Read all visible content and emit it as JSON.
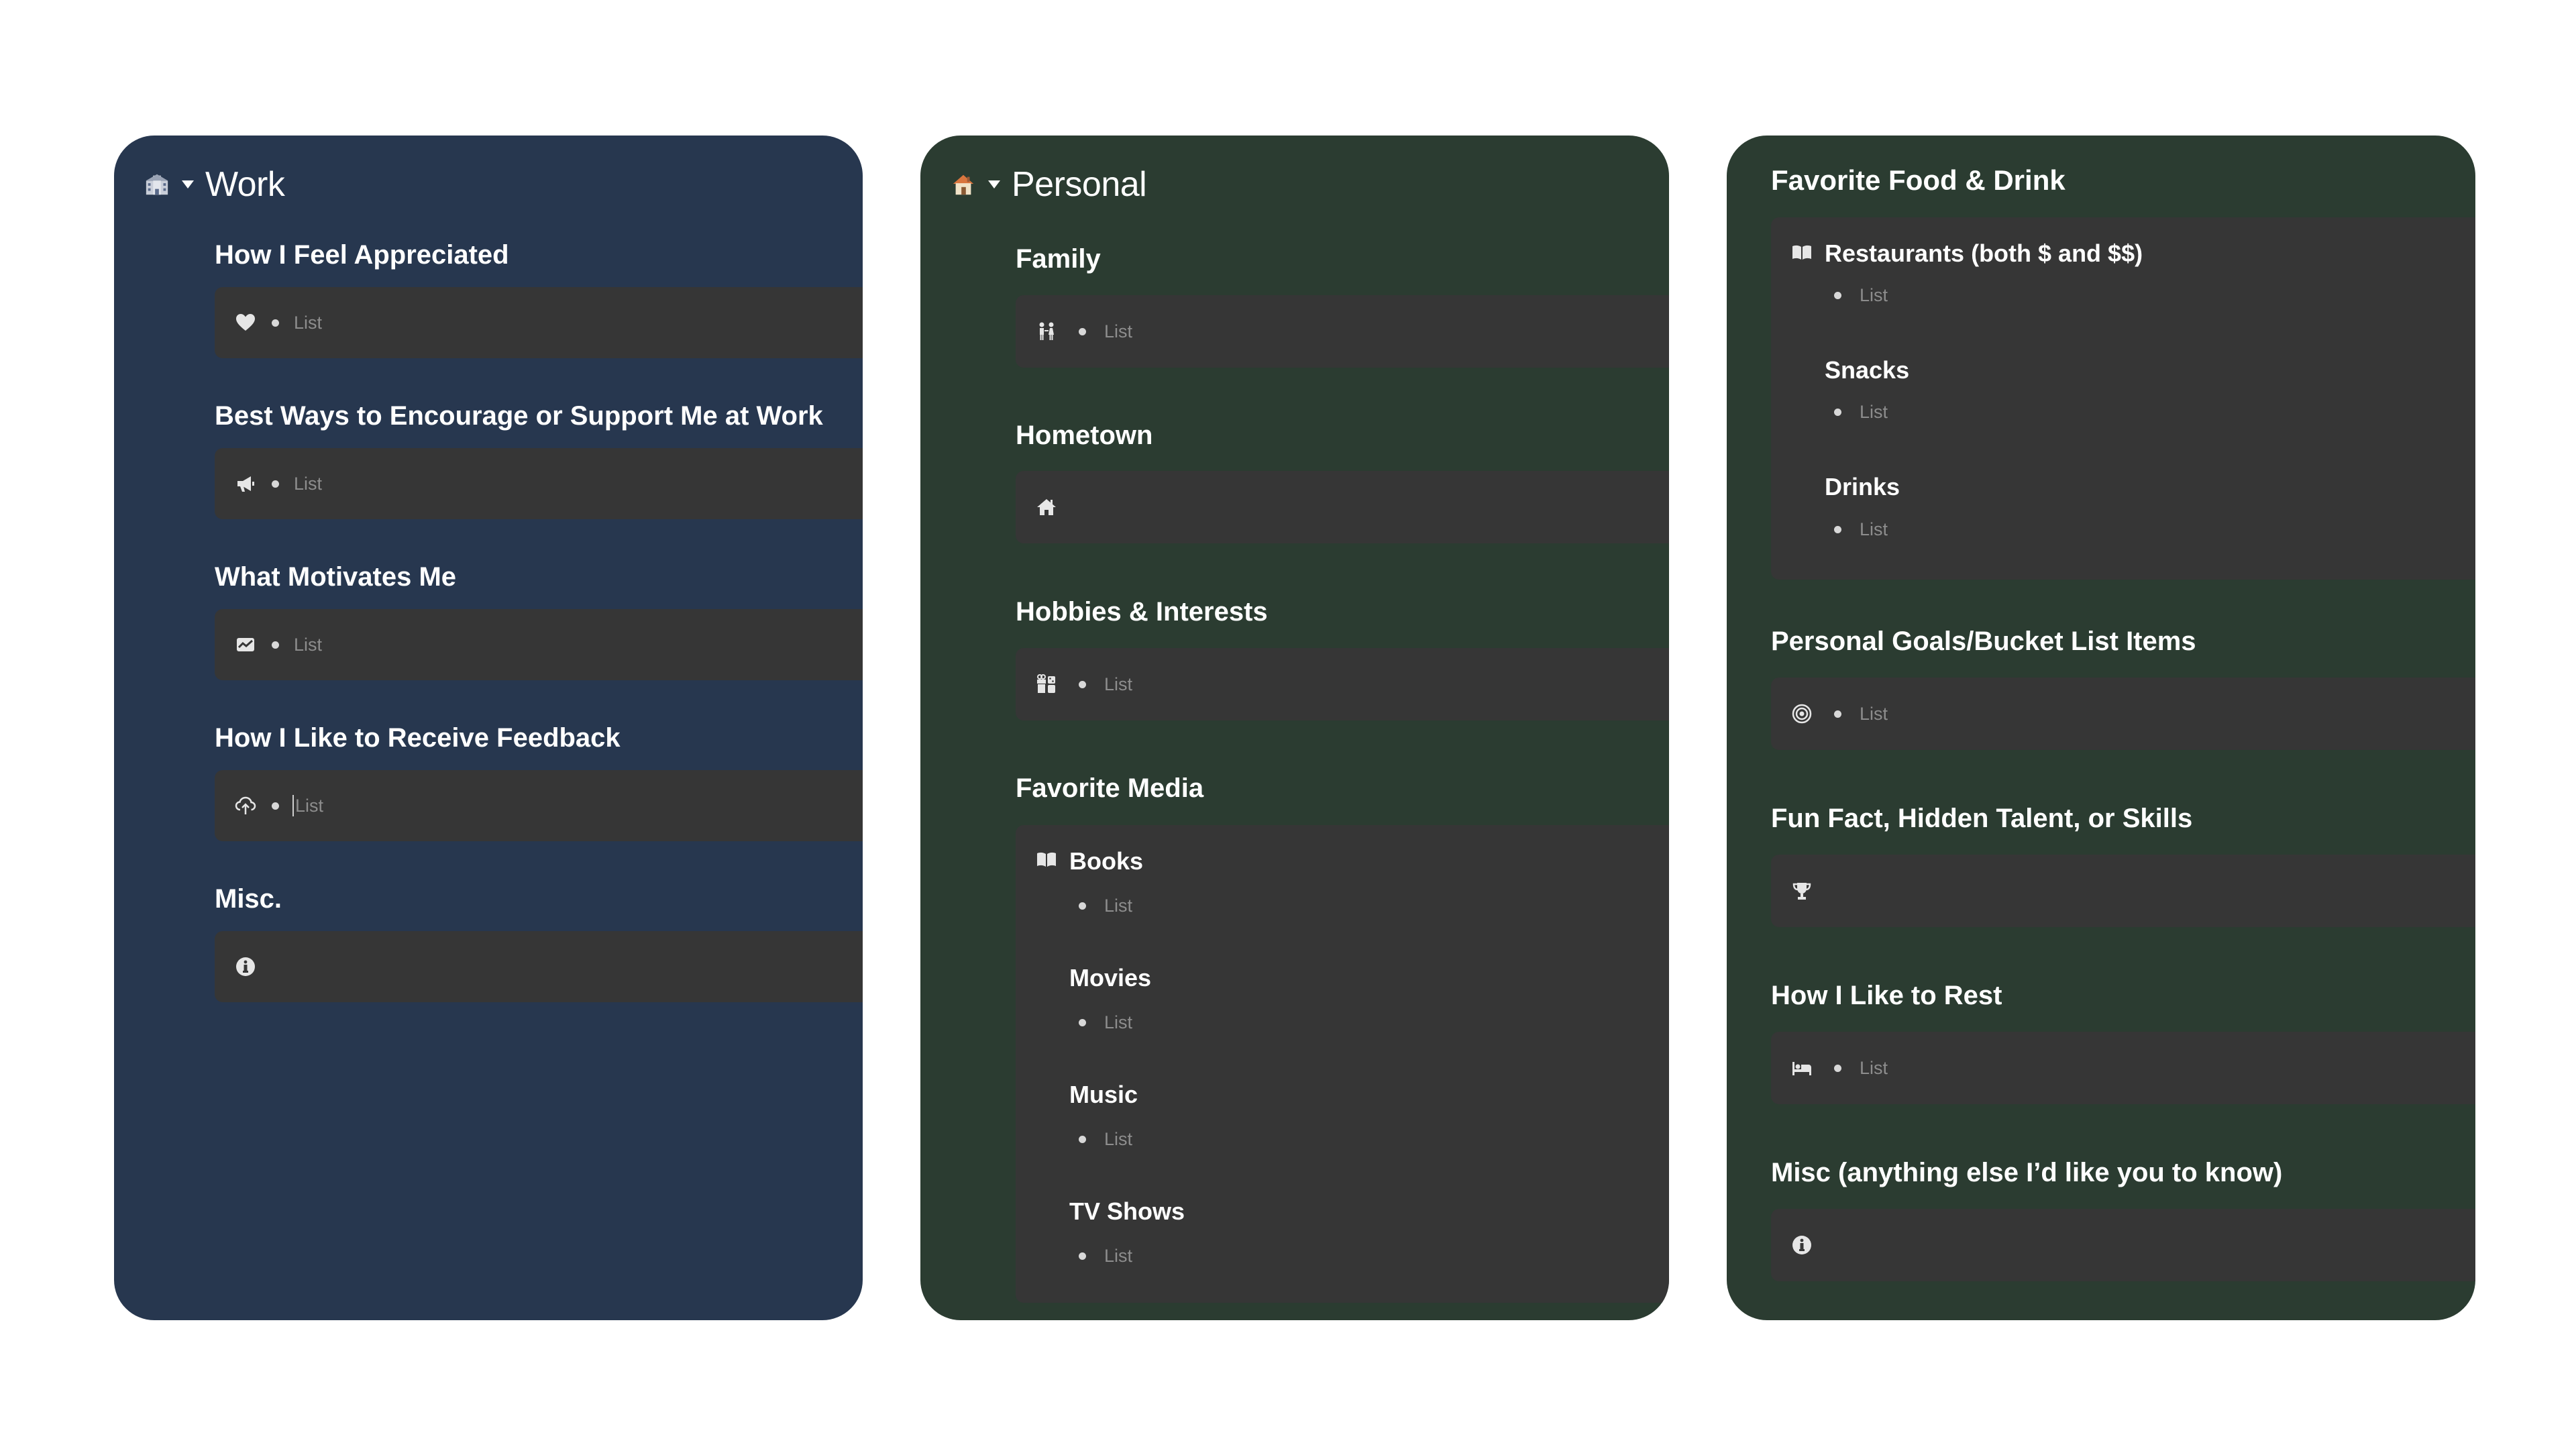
{
  "work": {
    "title": "Work",
    "sections": [
      {
        "title": "How I Feel Appreciated",
        "icon": "heart-icon",
        "placeholder": "List"
      },
      {
        "title": "Best Ways to Encourage or Support Me at Work",
        "icon": "megaphone-icon",
        "placeholder": "List"
      },
      {
        "title": "What Motivates Me",
        "icon": "chart-card-icon",
        "placeholder": "List"
      },
      {
        "title": "How I Like to Receive Feedback",
        "icon": "cloud-upload-icon",
        "placeholder": "List"
      },
      {
        "title": "Misc.",
        "icon": "info-icon",
        "placeholder": ""
      }
    ]
  },
  "personal": {
    "title": "Personal",
    "sections": [
      {
        "title": "Family",
        "icon": "family-icon",
        "placeholder": "List"
      },
      {
        "title": "Hometown",
        "icon": "home-icon",
        "placeholder": ""
      },
      {
        "title": "Hobbies & Interests",
        "icon": "gift-icon",
        "placeholder": "List"
      },
      {
        "title": "Favorite Media",
        "icon": "book-icon",
        "placeholder": ""
      }
    ],
    "media": [
      {
        "title": "Books",
        "placeholder": "List"
      },
      {
        "title": "Movies",
        "placeholder": "List"
      },
      {
        "title": "Music",
        "placeholder": "List"
      },
      {
        "title": "TV Shows",
        "placeholder": "List"
      }
    ]
  },
  "food": {
    "title": "Favorite Food & Drink",
    "groups": [
      {
        "title": "Restaurants (both $ and $$)",
        "placeholder": "List"
      },
      {
        "title": "Snacks",
        "placeholder": "List"
      },
      {
        "title": "Drinks",
        "placeholder": "List"
      }
    ],
    "sections": [
      {
        "title": "Personal Goals/Bucket List Items",
        "icon": "target-icon",
        "placeholder": "List"
      },
      {
        "title": "Fun Fact, Hidden Talent, or Skills",
        "icon": "trophy-icon",
        "placeholder": ""
      },
      {
        "title": "How I Like to Rest",
        "icon": "bed-icon",
        "placeholder": "List"
      },
      {
        "title": "Misc (anything else I’d like you to know)",
        "icon": "info-icon",
        "placeholder": ""
      }
    ]
  },
  "colors": {
    "work_bg": "#27374f",
    "personal_bg": "#2b3c31",
    "callout_bg": "#363636",
    "placeholder_text": "#8d8d8d"
  }
}
